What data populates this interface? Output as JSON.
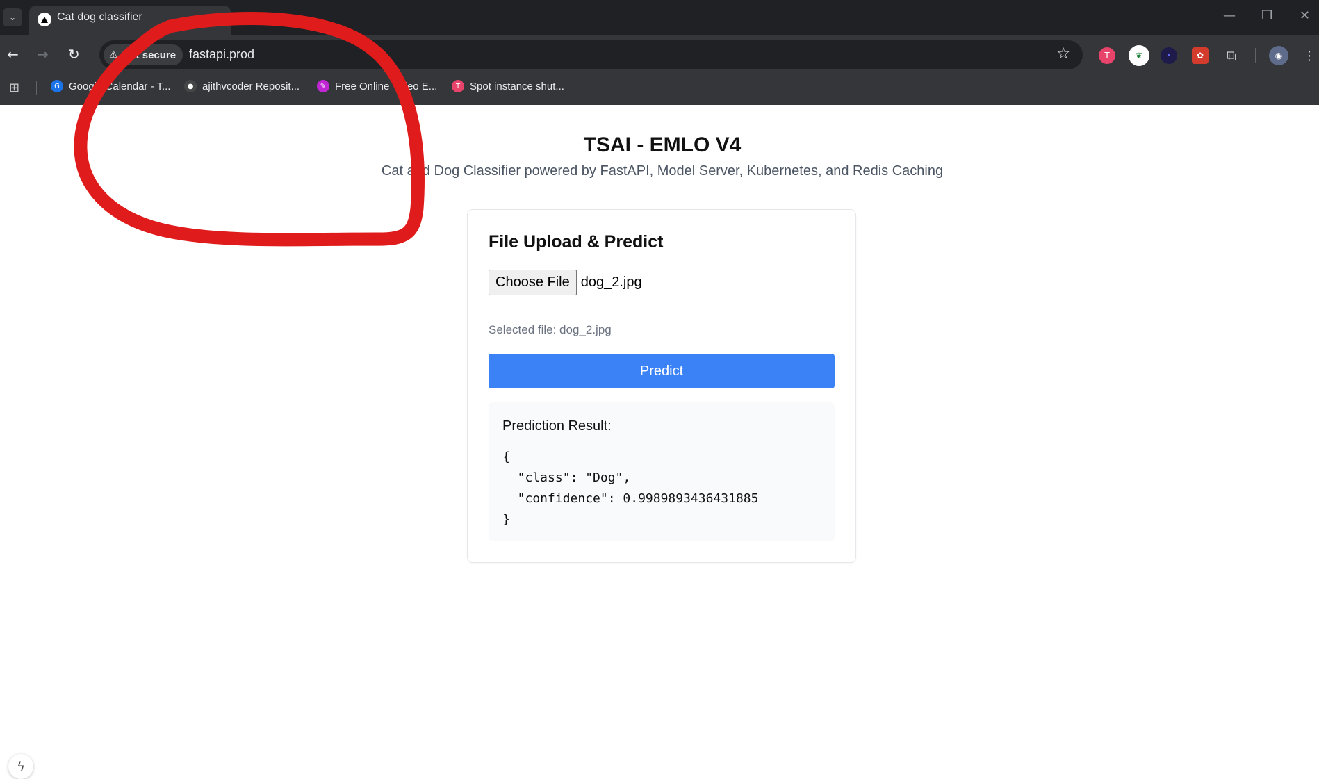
{
  "browser": {
    "tab": {
      "title": "Cat dog classifier",
      "close_glyph": "×"
    },
    "new_tab_glyph": "+",
    "window_controls": {
      "minimize": "—",
      "restore": "❐",
      "close": "✕"
    },
    "nav": {
      "back": "←",
      "forward": "→",
      "reload": "↻"
    },
    "omnibox": {
      "security_label": "Not secure",
      "url": "fastapi.prod"
    },
    "bookmarks": [
      {
        "label": "Google Calendar - T...",
        "icon": "google-calendar-icon",
        "color": "#1a73e8"
      },
      {
        "label": "ajithvcoder Reposit...",
        "icon": "github-icon",
        "color": "#444746"
      },
      {
        "label": "Free Online Video E...",
        "icon": "video-editor-icon",
        "color": "#c026d3"
      },
      {
        "label": "Spot instance shut...",
        "icon": "bookmark-app-icon",
        "color": "#e8436b"
      }
    ],
    "extensions": [
      {
        "name": "extension-pink-icon",
        "color": "#e8436b"
      },
      {
        "name": "extension-leaf-icon",
        "color": "#ffffff"
      },
      {
        "name": "extension-dark-icon",
        "color": "#1e1b4b"
      },
      {
        "name": "extension-red-icon",
        "color": "#d33b2c"
      }
    ]
  },
  "page": {
    "title": "TSAI - EMLO V4",
    "subtitle": "Cat and Dog Classifier powered by FastAPI, Model Server, Kubernetes, and Redis Caching",
    "card": {
      "title": "File Upload & Predict",
      "choose_file_label": "Choose File",
      "file_name": "dog_2.jpg",
      "selected_file_text": "Selected file: dog_2.jpg",
      "predict_label": "Predict",
      "result_label": "Prediction Result:",
      "result_json": "{\n  \"class\": \"Dog\",\n  \"confidence\": 0.9989893436431885\n}"
    }
  },
  "colors": {
    "primary": "#3b82f6",
    "annotation_stroke": "#e01b1b",
    "chrome_dark": "#202124",
    "chrome_toolbar": "#35363a"
  }
}
